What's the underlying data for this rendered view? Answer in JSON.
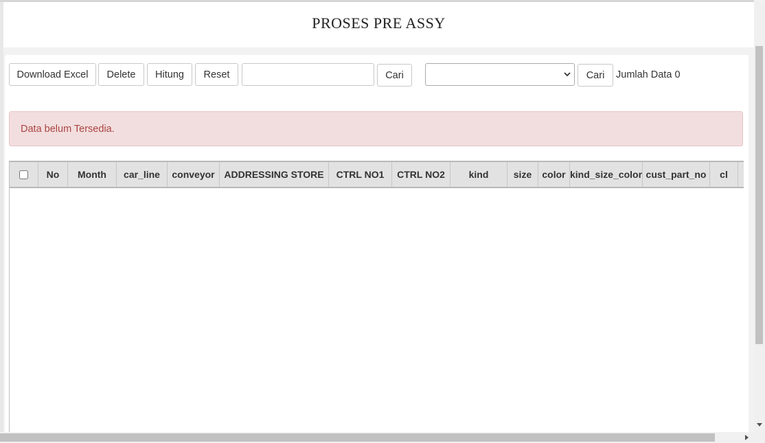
{
  "header": {
    "title": "PROSES PRE ASSY"
  },
  "toolbar": {
    "download_excel": "Download Excel",
    "delete": "Delete",
    "hitung": "Hitung",
    "reset": "Reset",
    "search_value": "",
    "cari_1": "Cari",
    "select_value": "",
    "cari_2": "Cari",
    "count_label": "Jumlah Data",
    "count_value": "0"
  },
  "alert": {
    "message": "Data belum Tersedia."
  },
  "table": {
    "columns": [
      "No",
      "Month",
      "car_line",
      "conveyor",
      "ADDRESSING STORE",
      "CTRL NO1",
      "CTRL NO2",
      "kind",
      "size",
      "color",
      "kind_size_color",
      "cust_part_no",
      "cl"
    ],
    "rows": []
  },
  "icons": {
    "select_chevron": "chevron-down-icon",
    "scroll_down": "scroll-down-arrow-icon",
    "scroll_right": "scroll-right-arrow-icon"
  }
}
